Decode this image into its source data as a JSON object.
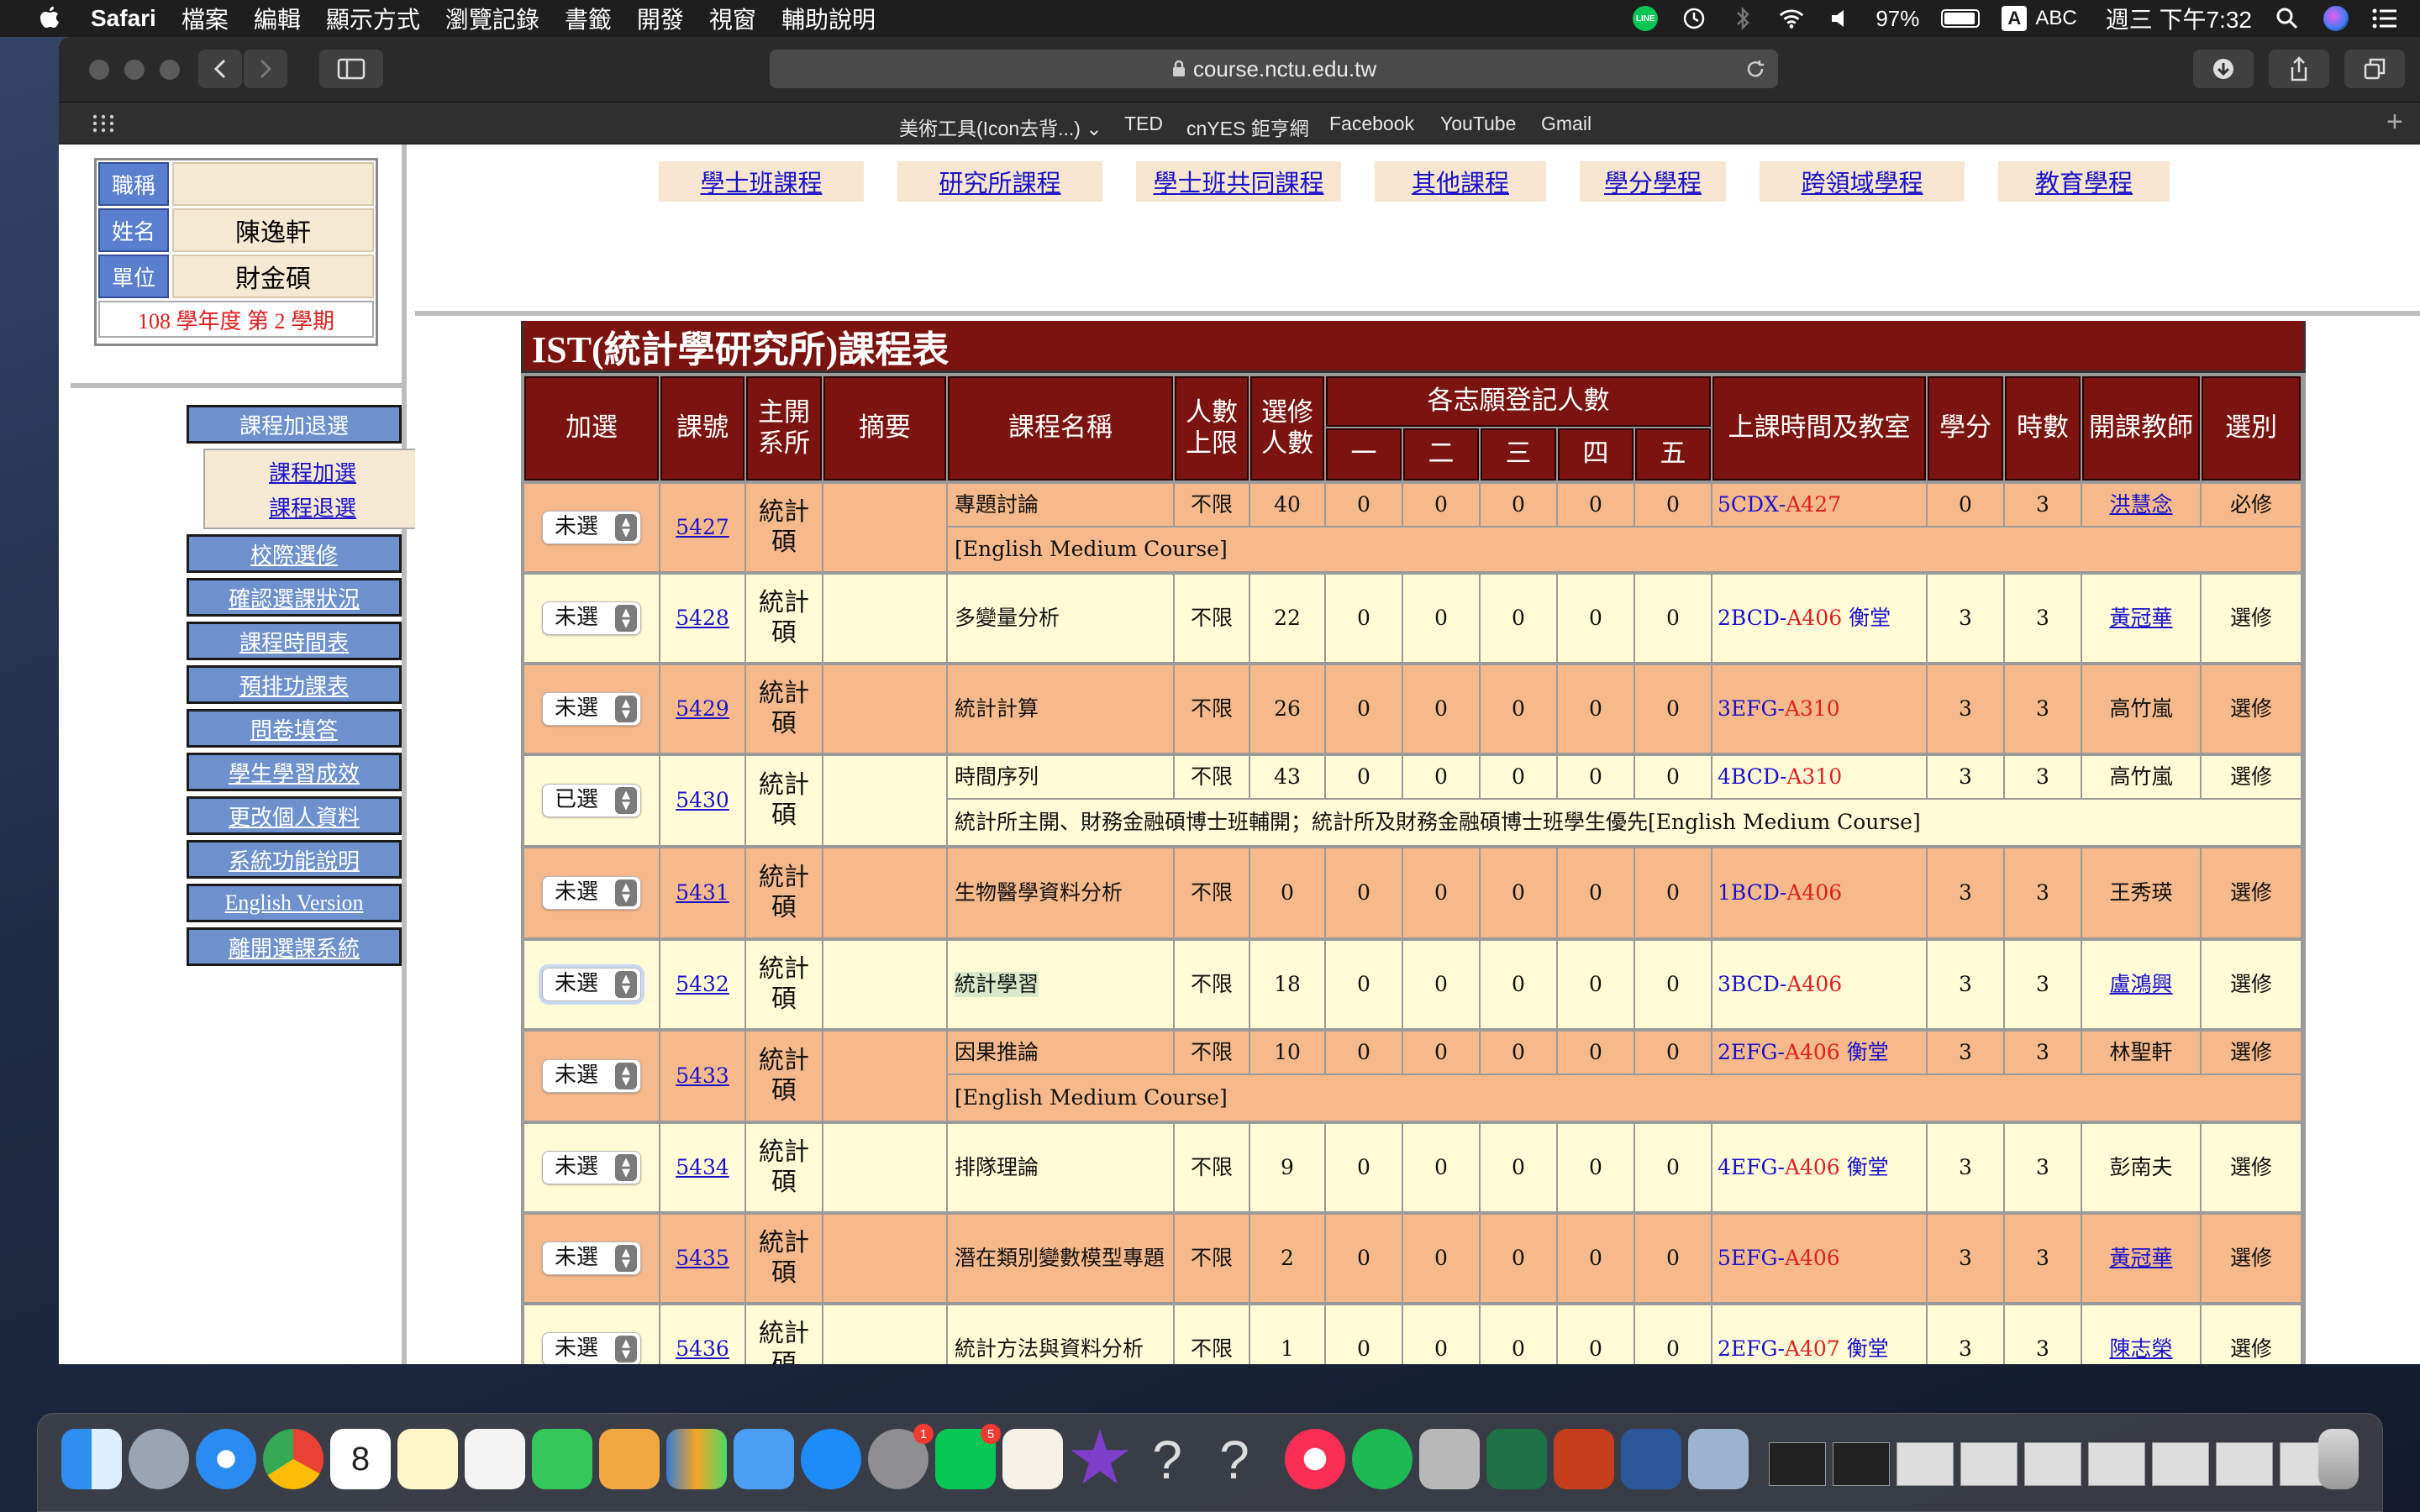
{
  "menubar": {
    "app": "Safari",
    "menus": [
      "檔案",
      "編輯",
      "顯示方式",
      "瀏覽記錄",
      "書籤",
      "開發",
      "視窗",
      "輔助說明"
    ],
    "battery": "97%",
    "input_method": "ABC",
    "input_badge": "A",
    "line_label": "LINE",
    "clock": "週三 下午7:32"
  },
  "browser": {
    "url": "course.nctu.edu.tw",
    "bookmarks": [
      "美術工具(Icon去背...)",
      "TED",
      "cnYES 鉅亨網",
      "Facebook",
      "YouTube",
      "Gmail"
    ]
  },
  "profile": {
    "rows": [
      {
        "label": "職稱",
        "value": ""
      },
      {
        "label": "姓名",
        "value": "陳逸軒"
      },
      {
        "label": "單位",
        "value": "財金碩"
      }
    ],
    "semester": "108 學年度 第 2 學期"
  },
  "nav": {
    "main_label": "課程加退選",
    "sub": [
      "課程加選",
      "課程退選"
    ],
    "items": [
      "校際選修",
      "確認選課狀況",
      "課程時間表",
      "預排功課表",
      "問卷填答",
      "學生學習成效",
      "更改個人資料",
      "系統功能說明",
      "English Version",
      "離開選課系統"
    ]
  },
  "tabs": [
    "學士班課程",
    "研究所課程",
    "學士班共同課程",
    "其他課程",
    "學分學程",
    "跨領域學程",
    "教育學程"
  ],
  "course_table": {
    "title": "IST(統計學研究所)課程表",
    "headers": {
      "add": "加選",
      "code": "課號",
      "dept": "主開系所",
      "summary": "摘要",
      "name": "課程名稱",
      "limit": "人數上限",
      "enrolled": "選修人數",
      "wish_group": "各志願登記人數",
      "wishes": [
        "一",
        "二",
        "三",
        "四",
        "五"
      ],
      "time": "上課時間及教室",
      "credits": "學分",
      "hours": "時數",
      "teacher": "開課教師",
      "type": "選別"
    },
    "rows": [
      {
        "select": "未選",
        "code": "5427",
        "dept": "統計碩",
        "name": "專題討論",
        "limit": "不限",
        "enrolled": "40",
        "wishes": [
          "0",
          "0",
          "0",
          "0",
          "0"
        ],
        "time_code": "5CDX",
        "room": "A427",
        "extra": "",
        "credits": "0",
        "hours": "3",
        "teacher": "洪慧念",
        "teacher_link": true,
        "type": "必修",
        "note": "[English Medium Course]"
      },
      {
        "select": "未選",
        "code": "5428",
        "dept": "統計碩",
        "name": "多變量分析",
        "limit": "不限",
        "enrolled": "22",
        "wishes": [
          "0",
          "0",
          "0",
          "0",
          "0"
        ],
        "time_code": "2BCD",
        "room": "A406",
        "extra": "衡堂",
        "credits": "3",
        "hours": "3",
        "teacher": "黃冠華",
        "teacher_link": true,
        "type": "選修",
        "note": ""
      },
      {
        "select": "未選",
        "code": "5429",
        "dept": "統計碩",
        "name": "統計計算",
        "limit": "不限",
        "enrolled": "26",
        "wishes": [
          "0",
          "0",
          "0",
          "0",
          "0"
        ],
        "time_code": "3EFG",
        "room": "A310",
        "extra": "",
        "credits": "3",
        "hours": "3",
        "teacher": "高竹嵐",
        "teacher_link": false,
        "type": "選修",
        "note": ""
      },
      {
        "select": "已選",
        "code": "5430",
        "dept": "統計碩",
        "name": "時間序列",
        "limit": "不限",
        "enrolled": "43",
        "wishes": [
          "0",
          "0",
          "0",
          "0",
          "0"
        ],
        "time_code": "4BCD",
        "room": "A310",
        "extra": "",
        "credits": "3",
        "hours": "3",
        "teacher": "高竹嵐",
        "teacher_link": false,
        "type": "選修",
        "note": "統計所主開、財務金融碩博士班輔開；統計所及財務金融碩博士班學生優先[English Medium Course]"
      },
      {
        "select": "未選",
        "code": "5431",
        "dept": "統計碩",
        "name": "生物醫學資料分析",
        "limit": "不限",
        "enrolled": "0",
        "wishes": [
          "0",
          "0",
          "0",
          "0",
          "0"
        ],
        "time_code": "1BCD",
        "room": "A406",
        "extra": "",
        "credits": "3",
        "hours": "3",
        "teacher": "王秀瑛",
        "teacher_link": false,
        "type": "選修",
        "note": ""
      },
      {
        "select": "未選",
        "code": "5432",
        "dept": "統計碩",
        "name": "統計學習",
        "limit": "不限",
        "enrolled": "18",
        "wishes": [
          "0",
          "0",
          "0",
          "0",
          "0"
        ],
        "time_code": "3BCD",
        "room": "A406",
        "extra": "",
        "credits": "3",
        "hours": "3",
        "teacher": "盧鴻興",
        "teacher_link": true,
        "type": "選修",
        "note": ""
      },
      {
        "select": "未選",
        "code": "5433",
        "dept": "統計碩",
        "name": "因果推論",
        "limit": "不限",
        "enrolled": "10",
        "wishes": [
          "0",
          "0",
          "0",
          "0",
          "0"
        ],
        "time_code": "2EFG",
        "room": "A406",
        "extra": "衡堂",
        "credits": "3",
        "hours": "3",
        "teacher": "林聖軒",
        "teacher_link": false,
        "type": "選修",
        "note": "[English Medium Course]"
      },
      {
        "select": "未選",
        "code": "5434",
        "dept": "統計碩",
        "name": "排隊理論",
        "limit": "不限",
        "enrolled": "9",
        "wishes": [
          "0",
          "0",
          "0",
          "0",
          "0"
        ],
        "time_code": "4EFG",
        "room": "A406",
        "extra": "衡堂",
        "credits": "3",
        "hours": "3",
        "teacher": "彭南夫",
        "teacher_link": false,
        "type": "選修",
        "note": ""
      },
      {
        "select": "未選",
        "code": "5435",
        "dept": "統計碩",
        "name": "潛在類別變數模型專題",
        "limit": "不限",
        "enrolled": "2",
        "wishes": [
          "0",
          "0",
          "0",
          "0",
          "0"
        ],
        "time_code": "5EFG",
        "room": "A406",
        "extra": "",
        "credits": "3",
        "hours": "3",
        "teacher": "黃冠華",
        "teacher_link": true,
        "type": "選修",
        "note": ""
      },
      {
        "select": "未選",
        "code": "5436",
        "dept": "統計碩",
        "name": "統計方法與資料分析",
        "limit": "不限",
        "enrolled": "1",
        "wishes": [
          "0",
          "0",
          "0",
          "0",
          "0"
        ],
        "time_code": "2EFG",
        "room": "A407",
        "extra": "衡堂",
        "credits": "3",
        "hours": "3",
        "teacher": "陳志榮",
        "teacher_link": true,
        "type": "選修",
        "note": ""
      }
    ]
  },
  "dock": {
    "calendar_day": "8",
    "app_store_badge": "1",
    "line_badge": "5"
  }
}
